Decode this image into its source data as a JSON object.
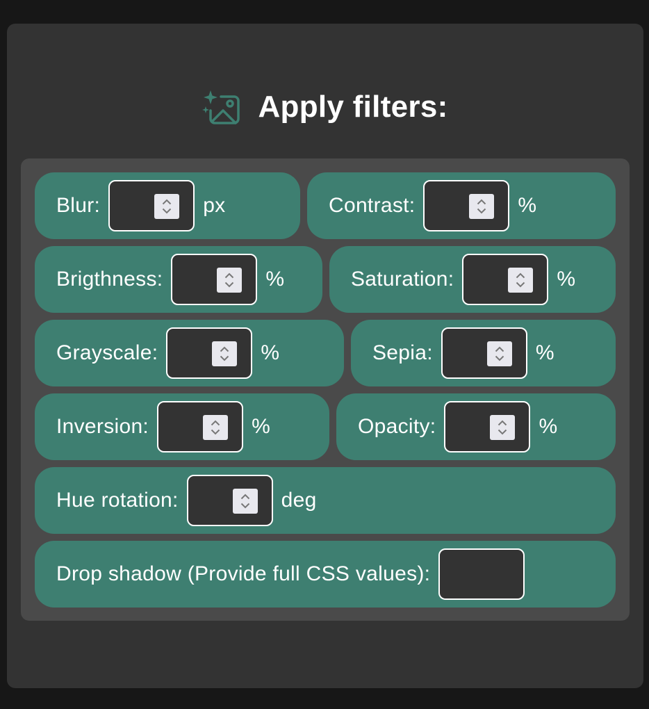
{
  "header": {
    "title": "Apply filters:",
    "icon": "image-sparkle-icon",
    "icon_color": "#3e7f71"
  },
  "colors": {
    "page_bg": "#171717",
    "panel_bg": "#333333",
    "filters_bg": "#4a4a4a",
    "pill_bg": "#3e7f71",
    "input_bg": "#333333",
    "input_border": "#ffffff"
  },
  "filters": {
    "blur": {
      "label": "Blur:",
      "value": "",
      "unit": "px"
    },
    "contrast": {
      "label": "Contrast:",
      "value": "",
      "unit": "%"
    },
    "brightness": {
      "label": "Brigthness:",
      "value": "",
      "unit": "%"
    },
    "saturation": {
      "label": "Saturation:",
      "value": "",
      "unit": "%"
    },
    "grayscale": {
      "label": "Grayscale:",
      "value": "",
      "unit": "%"
    },
    "sepia": {
      "label": "Sepia:",
      "value": "",
      "unit": "%"
    },
    "inversion": {
      "label": "Inversion:",
      "value": "",
      "unit": "%"
    },
    "opacity": {
      "label": "Opacity:",
      "value": "",
      "unit": "%"
    },
    "hue_rotation": {
      "label": "Hue rotation:",
      "value": "",
      "unit": "deg"
    },
    "drop_shadow": {
      "label": "Drop shadow (Provide full CSS values):",
      "value": ""
    }
  }
}
